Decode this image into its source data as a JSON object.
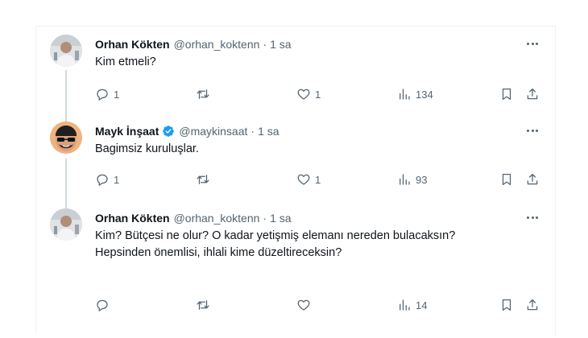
{
  "tweets": [
    {
      "name": "Orhan Kökten",
      "handle": "@orhan_koktenn",
      "separator": "·",
      "time": "1 sa",
      "verified": false,
      "text": "Kim etmeli?",
      "replies": "1",
      "retweets": "",
      "likes": "1",
      "views": "134",
      "avatar_icon": "avatar-orhan"
    },
    {
      "name": "Mayk İnşaat",
      "handle": "@maykinsaat",
      "separator": "·",
      "time": "1 sa",
      "verified": true,
      "text": "Bagimsiz kuruluşlar.",
      "replies": "1",
      "retweets": "",
      "likes": "1",
      "views": "93",
      "avatar_icon": "avatar-mayk"
    },
    {
      "name": "Orhan Kökten",
      "handle": "@orhan_koktenn",
      "separator": "·",
      "time": "1 sa",
      "verified": false,
      "text_line1": "Kim? Bütçesi ne olur? O kadar yetişmiş elemanı nereden bulacaksın?",
      "text_line2": "Hepsinden önemlisi, ihlali kime düzeltireceksin?",
      "replies": "",
      "retweets": "",
      "likes": "",
      "views": "14",
      "avatar_icon": "avatar-orhan"
    }
  ],
  "colors": {
    "text": "#0f1419",
    "secondary": "#536471",
    "verified_blue": "#1d9bf0",
    "thread_line": "#cfd9de",
    "divider": "#eff3f4"
  }
}
